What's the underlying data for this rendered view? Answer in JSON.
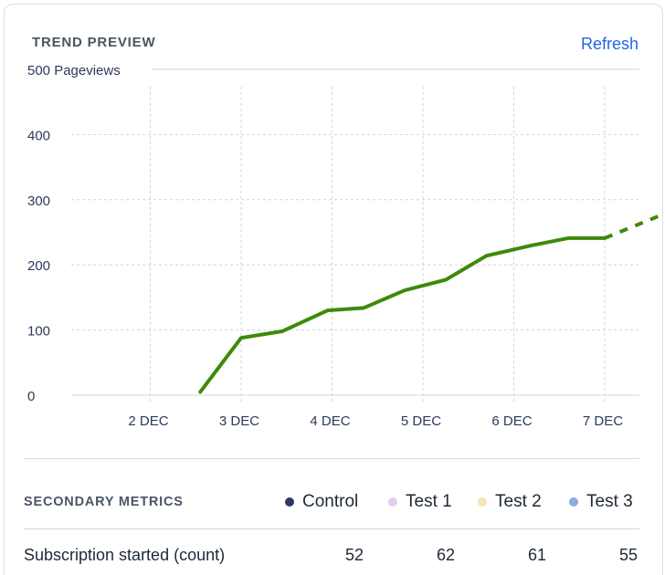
{
  "header": {
    "title": "TREND PREVIEW",
    "refresh_label": "Refresh"
  },
  "colors": {
    "line": "#3d8a08",
    "grid": "#d0d4d9",
    "axis_text": "#2d3a5a",
    "accent": "#2563eb"
  },
  "chart_data": {
    "type": "line",
    "title": "",
    "ylabel": "500 Pageviews",
    "xlabel": "",
    "ylim": [
      0,
      500
    ],
    "yticks": [
      "0",
      "100",
      "200",
      "300",
      "400"
    ],
    "categories": [
      "2 DEC",
      "3 DEC",
      "4 DEC",
      "5 DEC",
      "6 DEC",
      "7 DEC"
    ],
    "grid": true,
    "series": [
      {
        "name": "",
        "x": [
          1.55,
          2.0,
          2.45,
          2.95,
          3.35,
          3.8,
          4.25,
          4.7,
          5.2,
          5.6,
          6.0,
          7.0
        ],
        "y": [
          5,
          88,
          98,
          130,
          134,
          161,
          177,
          214,
          230,
          241,
          241,
          298
        ],
        "solid_until_index": 10
      }
    ]
  },
  "secondary": {
    "title": "SECONDARY METRICS",
    "legend": [
      {
        "label": "Control",
        "color": "#2b3a66"
      },
      {
        "label": "Test 1",
        "color": "#e3cdee"
      },
      {
        "label": "Test 2",
        "color": "#f6e3b4"
      },
      {
        "label": "Test 3",
        "color": "#8fa8e8"
      }
    ],
    "rows": [
      {
        "label": "Subscription started (count)",
        "values": [
          "52",
          "62",
          "61",
          "55"
        ]
      }
    ]
  }
}
